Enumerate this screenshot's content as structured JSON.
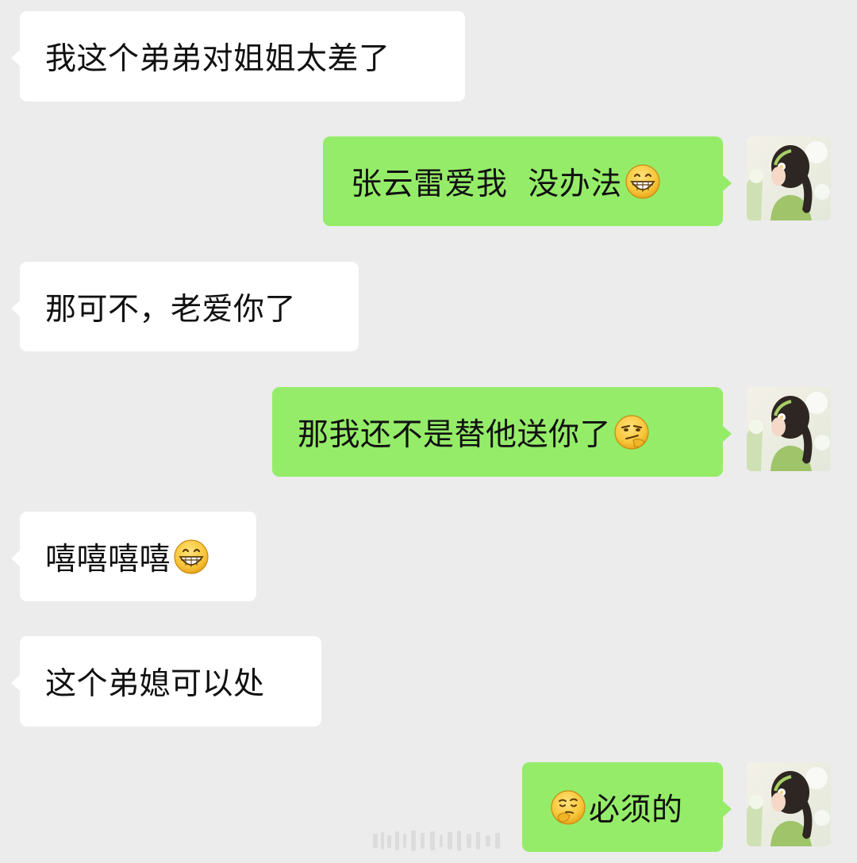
{
  "chat": {
    "messages": [
      {
        "side": "incoming",
        "text": "我这个弟弟对姐姐太差了",
        "emoji_after": ""
      },
      {
        "side": "outgoing",
        "text": "张云雷爱我  没办法",
        "emoji_after": "grin-emoji"
      },
      {
        "side": "incoming",
        "text": "那可不，老爱你了",
        "emoji_after": ""
      },
      {
        "side": "outgoing",
        "text": "那我还不是替他送你了",
        "emoji_after": "smirk-emoji"
      },
      {
        "side": "incoming",
        "text": "嘻嘻嘻嘻",
        "emoji_after": "grin-emoji"
      },
      {
        "side": "incoming",
        "text": "这个弟媳可以处",
        "emoji_after": ""
      },
      {
        "side": "outgoing",
        "text": "必须的",
        "emoji_before": "thinking-emoji"
      }
    ]
  },
  "colors": {
    "background": "#ececec",
    "incoming_bubble": "#ffffff",
    "outgoing_bubble": "#95ec69",
    "text": "#111111"
  },
  "avatar": {
    "icon": "avatar-girl-green-dress"
  }
}
